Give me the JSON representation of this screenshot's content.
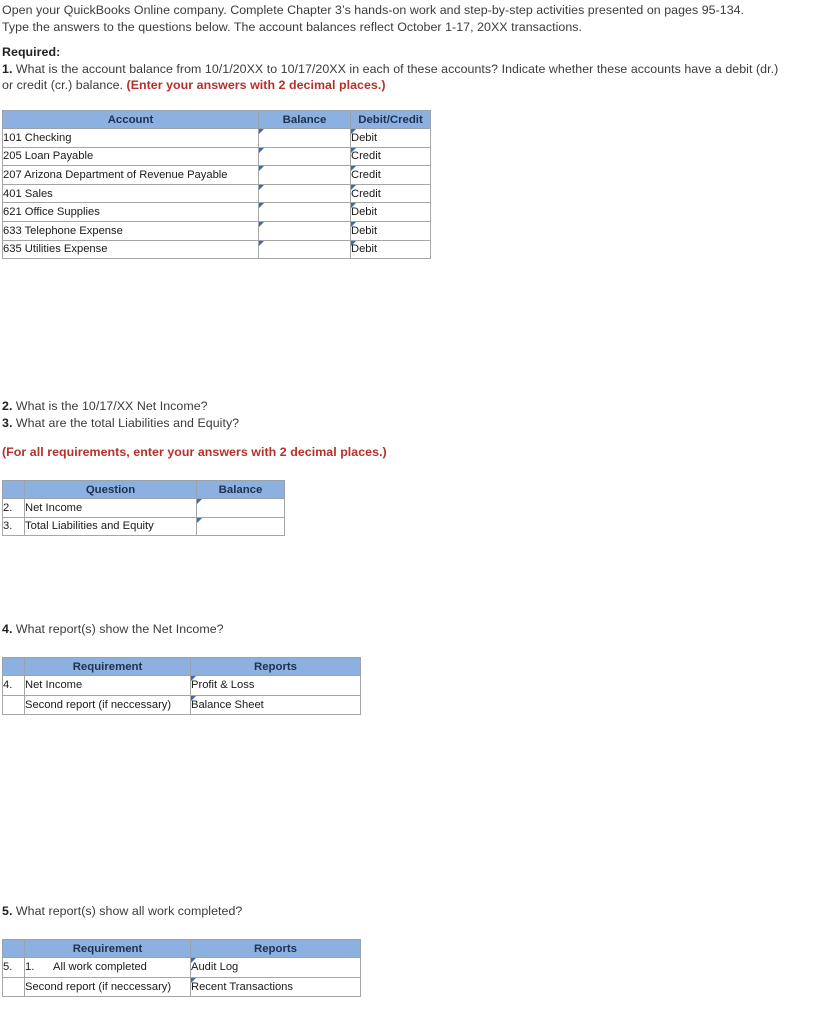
{
  "intro": {
    "line1": "Open your QuickBooks Online company. Complete Chapter 3’s hands-on work and step-by-step activities presented on pages 95-134.",
    "line2": "Type the answers to the questions below. The account balances reflect October 1-17, 20XX transactions."
  },
  "required": {
    "heading": "Required:",
    "q1_number": "1.",
    "q1_text": " What is the account balance from 10/1/20XX to 10/17/20XX in each of these accounts? Indicate whether these accounts have a debit (dr.) or credit (cr.) balance. ",
    "q1_note": "(Enter your answers with 2 decimal places.)"
  },
  "accounts_table": {
    "headers": [
      "Account",
      "Balance",
      "Debit/Credit"
    ],
    "rows": [
      {
        "account": "101 Checking",
        "balance": "",
        "debit_credit": "Debit"
      },
      {
        "account": "205 Loan Payable",
        "balance": "",
        "debit_credit": "Credit"
      },
      {
        "account": "207 Arizona Department of Revenue Payable",
        "balance": "",
        "debit_credit": "Credit"
      },
      {
        "account": "401 Sales",
        "balance": "",
        "debit_credit": "Credit"
      },
      {
        "account": "621 Office Supplies",
        "balance": "",
        "debit_credit": "Debit"
      },
      {
        "account": "633 Telephone Expense",
        "balance": "",
        "debit_credit": "Debit"
      },
      {
        "account": "635 Utilities Expense",
        "balance": "",
        "debit_credit": "Debit"
      }
    ]
  },
  "questions_23": {
    "q2_number": "2.",
    "q2_text": " What is the 10/17/XX Net Income?",
    "q3_number": "3.",
    "q3_text": " What are the total Liabilities and Equity?",
    "note": "(For all requirements, enter your answers with 2 decimal places.)"
  },
  "questions_table": {
    "headers": [
      "",
      "Question",
      "Balance"
    ],
    "rows": [
      {
        "index": "2.",
        "question": "Net Income",
        "balance": ""
      },
      {
        "index": "3.",
        "question": "Total Liabilities and Equity",
        "balance": ""
      }
    ]
  },
  "question_4": {
    "number": "4.",
    "text": " What report(s) show the Net Income?",
    "table": {
      "headers": [
        "",
        "Requirement",
        "Reports"
      ],
      "rows": [
        {
          "index": "4.",
          "requirement": "Net Income",
          "report": "Profit & Loss"
        },
        {
          "index": "",
          "requirement": "Second report (if neccessary)",
          "report": "Balance Sheet"
        }
      ]
    }
  },
  "question_5": {
    "number": "5.",
    "text": " What report(s) show all work completed?",
    "table": {
      "headers": [
        "",
        "Requirement",
        "Reports"
      ],
      "rows": [
        {
          "index": "5.",
          "requirement_prefix": "1.",
          "requirement": "All work completed",
          "report": "Audit Log"
        },
        {
          "index": "",
          "requirement_prefix": "",
          "requirement": "Second report (if neccessary)",
          "report": "Recent Transactions"
        }
      ]
    }
  },
  "colors": {
    "header_blue": "#8cb0e0",
    "entry_border_blue": "#4a6fa5",
    "marker_blue": "#3f6aa8",
    "note_red": "#b5302b",
    "grid_gray": "#a6a6a6"
  }
}
